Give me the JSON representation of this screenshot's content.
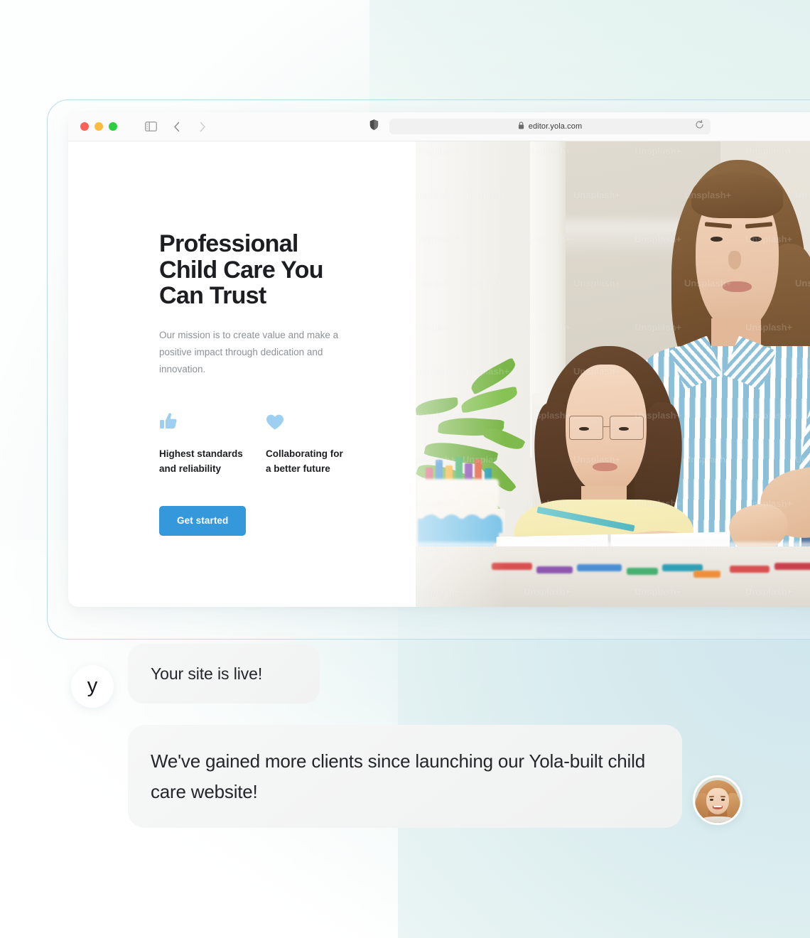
{
  "browser": {
    "url": "editor.yola.com",
    "lock_icon": "lock-icon",
    "reload_icon": "reload-icon",
    "sidebar_icon": "sidebar-toggle-icon",
    "back_icon": "chevron-left-icon",
    "forward_icon": "chevron-right-icon",
    "shield_icon": "privacy-shield-icon",
    "traffic_lights": [
      {
        "name": "close",
        "color": "#fc6058"
      },
      {
        "name": "minimize",
        "color": "#fcbd3f"
      },
      {
        "name": "maximize",
        "color": "#2ecc40"
      }
    ]
  },
  "site": {
    "hero": {
      "title": "Professional\nChild Care You\nCan Trust",
      "subtitle": "Our mission is to create value and make a positive impact through dedication and innovation.",
      "cta_label": "Get started",
      "cta_color": "#3498db"
    },
    "features": [
      {
        "icon": "thumbs-up-icon",
        "label": "Highest standards\nand reliability",
        "icon_color": "#9ccff0"
      },
      {
        "icon": "heart-icon",
        "label": "Collaborating for\na better future",
        "icon_color": "#9ccff0"
      }
    ],
    "photo": {
      "alt": "Adult helping a girl with homework at a table",
      "watermark_text": "Unsplash+"
    }
  },
  "chat": {
    "brand_avatar_letter": "y",
    "messages": [
      {
        "name": "status-message",
        "text": "Your site is live!"
      },
      {
        "name": "testimonial-message",
        "text": "We've gained more clients since launching our Yola-built child care website!"
      }
    ],
    "client_avatar": "client-avatar-photo"
  },
  "theme": {
    "accent": "#3498db",
    "icon_blue": "#9ccff0",
    "card_border": "#bcdcea",
    "bubble_bg": "#f2f3f3"
  }
}
